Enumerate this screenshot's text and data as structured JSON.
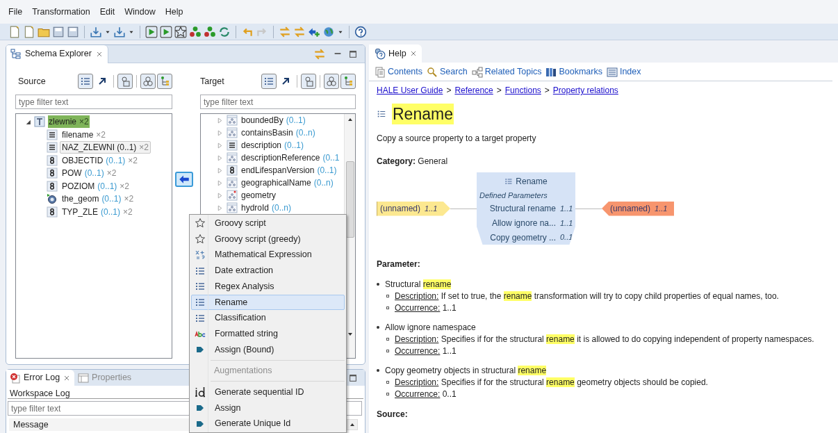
{
  "menu_bar": [
    "File",
    "Transformation",
    "Edit",
    "Window",
    "Help"
  ],
  "schema_explorer": {
    "tab": "Schema Explorer",
    "source": {
      "label": "Source",
      "filter_placeholder": "type filter text",
      "tree": [
        {
          "name": "zlewnie",
          "count": "×2",
          "expanded": true,
          "highlighted": true,
          "children": [
            {
              "name": "filename",
              "count": "×2",
              "selected": false
            },
            {
              "name": "NAZ_ZLEWNI (0..1)",
              "count": "×2",
              "selected": true
            },
            {
              "name": "OBJECTID",
              "multiplicity": "(0..1)",
              "count": "×2",
              "selected": false
            },
            {
              "name": "POW",
              "multiplicity": "(0..1)",
              "count": "×2",
              "selected": false
            },
            {
              "name": "POZIOM",
              "multiplicity": "(0..1)",
              "count": "×2",
              "selected": false
            },
            {
              "name": "the_geom",
              "multiplicity": "(0..1)",
              "count": "×2",
              "selected": false
            },
            {
              "name": "TYP_ZLE",
              "multiplicity": "(0..1)",
              "count": "×2",
              "selected": false
            }
          ]
        }
      ]
    },
    "target": {
      "label": "Target",
      "filter_placeholder": "type filter text",
      "tree": [
        {
          "name": "boundedBy",
          "multiplicity": "(0..1)",
          "expanded": false
        },
        {
          "name": "containsBasin",
          "multiplicity": "(0..n)",
          "expanded": false
        },
        {
          "name": "description",
          "multiplicity": "(0..1)",
          "expanded": false
        },
        {
          "name": "descriptionReference",
          "multiplicity": "(0..1",
          "expanded": false
        },
        {
          "name": "endLifespanVersion",
          "multiplicity": "(0..1)",
          "expanded": false
        },
        {
          "name": "geographicalName",
          "multiplicity": "(0..n)",
          "expanded": false
        },
        {
          "name": "geometry",
          "expanded": false
        },
        {
          "name": "hydroId",
          "multiplicity": "(0..n)",
          "expanded": false
        }
      ]
    }
  },
  "context_menu": [
    {
      "kind": "item",
      "label": "Groovy script",
      "selected": false
    },
    {
      "kind": "item",
      "label": "Groovy script (greedy)",
      "selected": false
    },
    {
      "kind": "item",
      "label": "Mathematical Expression",
      "selected": false
    },
    {
      "kind": "item",
      "label": "Date extraction",
      "selected": false
    },
    {
      "kind": "item",
      "label": "Regex Analysis",
      "selected": false
    },
    {
      "kind": "item",
      "label": "Rename",
      "selected": true
    },
    {
      "kind": "item",
      "label": "Classification",
      "selected": false
    },
    {
      "kind": "item",
      "label": "Formatted string",
      "selected": false
    },
    {
      "kind": "item",
      "label": "Assign (Bound)",
      "selected": false
    },
    {
      "kind": "separator"
    },
    {
      "kind": "header",
      "label": "Augmentations"
    },
    {
      "kind": "separator"
    },
    {
      "kind": "item",
      "label": "Generate sequential ID",
      "selected": false
    },
    {
      "kind": "item",
      "label": "Assign",
      "selected": false
    },
    {
      "kind": "item",
      "label": "Generate Unique Id",
      "selected": false
    }
  ],
  "bottom_panel": {
    "tabs": [
      {
        "label": "Error Log",
        "selected": true
      },
      {
        "label": "Properties",
        "selected": false
      }
    ],
    "title": "Workspace Log",
    "filter_placeholder": "type filter text",
    "columns": [
      "Message"
    ]
  },
  "help": {
    "tab": "Help",
    "toolbar": [
      "Contents",
      "Search",
      "Related Topics",
      "Bookmarks",
      "Index"
    ],
    "breadcrumb": [
      "HALE User Guide",
      "Reference",
      "Functions",
      "Property relations"
    ],
    "breadcrumb_separator": ">",
    "title": "Rename",
    "summary": "Copy a source property to a target property",
    "category": {
      "label": "Category:",
      "value": "General"
    },
    "diagram": {
      "source": {
        "name": "(unnamed)",
        "occurrence": "1..1"
      },
      "function": {
        "title": "Rename",
        "subtitle": "Defined Parameters",
        "parameters": [
          {
            "name": "Structural rename",
            "occurrence": "1..1"
          },
          {
            "name": "Allow ignore na...",
            "occurrence": "1..1"
          },
          {
            "name": "Copy geometry ...",
            "occurrence": "0..1"
          }
        ]
      },
      "target": {
        "name": "(unnamed)",
        "occurrence": "1..1"
      }
    },
    "parameter_heading": "Parameter:",
    "parameters": [
      {
        "name": [
          {
            "text": "Structural ",
            "highlighted": false
          },
          {
            "text": "rename",
            "highlighted": true
          }
        ],
        "description": {
          "label": "Description:",
          "text": [
            {
              "text": "If set to true, the ",
              "highlighted": false
            },
            {
              "text": "rename",
              "highlighted": true
            },
            {
              "text": " transformation will try to copy child properties of equal names, too.",
              "highlighted": false
            }
          ]
        },
        "occurrence": {
          "label": "Occurrence:",
          "value": "1..1"
        }
      },
      {
        "name": [
          {
            "text": "Allow ignore namespace",
            "highlighted": false
          }
        ],
        "description": {
          "label": "Description:",
          "text": [
            {
              "text": "Specifies if for the structural ",
              "highlighted": false
            },
            {
              "text": "rename",
              "highlighted": true
            },
            {
              "text": " it is allowed to do copying independent of property namespaces.",
              "highlighted": false
            }
          ]
        },
        "occurrence": {
          "label": "Occurrence:",
          "value": "1..1"
        }
      },
      {
        "name": [
          {
            "text": "Copy geometry objects in structural ",
            "highlighted": false
          },
          {
            "text": "rename",
            "highlighted": true
          }
        ],
        "description": {
          "label": "Description:",
          "text": [
            {
              "text": "Specifies if for the structural ",
              "highlighted": false
            },
            {
              "text": "rename",
              "highlighted": true
            },
            {
              "text": " geometry objects should be copied.",
              "highlighted": false
            }
          ]
        },
        "occurrence": {
          "label": "Occurrence:",
          "value": "0..1"
        }
      }
    ],
    "source_heading": "Source:"
  }
}
